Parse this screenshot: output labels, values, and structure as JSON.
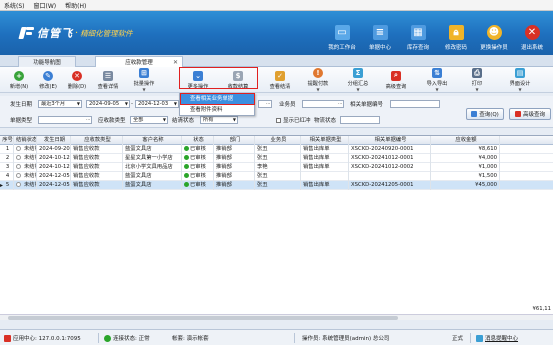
{
  "menu": [
    "系统(S)",
    "窗口(W)",
    "帮助(H)"
  ],
  "brand": {
    "name": "信管飞",
    "subtitle": "精细化管理软件"
  },
  "topnav": [
    {
      "label": "我的工作台",
      "icon": "monitor-icon",
      "color": "#5aa8e8"
    },
    {
      "label": "单据中心",
      "icon": "document-icon",
      "color": "#4f9be0"
    },
    {
      "label": "库存查询",
      "icon": "table-icon",
      "color": "#4f9be0"
    },
    {
      "label": "修改密码",
      "icon": "lock-icon",
      "color": "#f0b429"
    },
    {
      "label": "更换操作员",
      "icon": "user-icon",
      "color": "#f0b429"
    },
    {
      "label": "退出系统",
      "icon": "close-icon",
      "color": "#d93025"
    }
  ],
  "tabs": [
    {
      "label": "功能导航图",
      "active": false
    },
    {
      "label": "应收款管理",
      "active": true
    }
  ],
  "toolbar": [
    {
      "label": "新增(N)",
      "icon": "add-icon",
      "color": "#38a33a",
      "arrow": false
    },
    {
      "label": "修改(E)",
      "icon": "edit-icon",
      "color": "#3b7fd4",
      "arrow": false
    },
    {
      "label": "删除(D)",
      "icon": "delete-icon",
      "color": "#d93025",
      "arrow": false
    },
    {
      "label": "查看详情",
      "icon": "view-icon",
      "color": "#7a8aa0",
      "arrow": false
    },
    {
      "label": "批量操作",
      "icon": "batch-icon",
      "color": "#3b7fd4",
      "arrow": true
    },
    {
      "label": "更多操作",
      "icon": "more-icon",
      "color": "#3b7fd4",
      "arrow": true
    },
    {
      "label": "收款结算",
      "icon": "payment-icon",
      "color": "#9aa5b4",
      "arrow": false
    },
    {
      "label": "查看结清",
      "icon": "settled-icon",
      "color": "#e0a030",
      "arrow": false
    },
    {
      "label": "提醒付款",
      "icon": "remind-icon",
      "color": "#e07830",
      "arrow": true
    },
    {
      "label": "分组汇总",
      "icon": "group-icon",
      "color": "#3b9fd4",
      "arrow": true
    },
    {
      "label": "高级查询",
      "icon": "advanced-search-icon",
      "color": "#d93025",
      "arrow": false
    },
    {
      "label": "导入导出",
      "icon": "import-export-icon",
      "color": "#3b7fd4",
      "arrow": true
    },
    {
      "label": "打印",
      "icon": "print-icon",
      "color": "#5a6f8a",
      "arrow": true
    },
    {
      "label": "界面设计",
      "icon": "design-icon",
      "color": "#3b9fd4",
      "arrow": true
    }
  ],
  "dropdown": [
    "查看相关业务单据",
    "查看附件资料"
  ],
  "filters": {
    "date_label": "发生日期",
    "date_range": "最近3个月",
    "date_from": "2024-09-05",
    "date_to": "2024-12-03",
    "operator_label": "业务员",
    "ref_label": "相关单据编号",
    "unit_label": "单据类型",
    "type_label": "应收款类型",
    "type_value": "全部",
    "status_label": "结清状态",
    "status_value": "所有",
    "show_red_label": "显示已红冲",
    "logistics_label": "物流状态",
    "query_button": "查询(Q)",
    "advanced_button": "高级查询"
  },
  "table": {
    "columns": [
      "序号",
      "结销状态",
      "发生日期",
      "应收款类型",
      "客户名称",
      "状态",
      "部门",
      "业务员",
      "相关单据类型",
      "相关单据编号",
      "应收金额"
    ],
    "rows": [
      [
        "1",
        "未结销",
        "2024-09-20 00:00",
        "销售应收款",
        "蓝蛋文具店",
        "已审核",
        "推销部",
        "张丑",
        "销售出库单",
        "XSCKD-20240920-0001",
        "¥8,610"
      ],
      [
        "2",
        "未结销",
        "2024-10-12 00:00",
        "销售应收款",
        "星星文具第一小学店",
        "已审核",
        "推销部",
        "张丑",
        "销售出库单",
        "XSCKD-20241012-0001",
        "¥4,000"
      ],
      [
        "3",
        "未结销",
        "2024-10-12 00:00",
        "销售应收款",
        "北京小学文具用品店",
        "已审核",
        "推销部",
        "李艳",
        "销售出库单",
        "XSCKD-20241012-0002",
        "¥1,000"
      ],
      [
        "4",
        "未结销",
        "2024-12-05 00:00",
        "销售应收款",
        "蓝蛋文具店",
        "已审核",
        "推销部",
        "张丑",
        "",
        "",
        "¥1,500"
      ],
      [
        "5",
        "未结销",
        "2024-12-05 00:00",
        "销售应收款",
        "蓝蛋文具店",
        "已审核",
        "推销部",
        "张丑",
        "销售出库单",
        "XSCKD-20241205-0001",
        "¥45,000"
      ]
    ],
    "selected_row": 4,
    "total": "¥61,11"
  },
  "status": {
    "center": "应用中心: 127.0.0.1:7095",
    "connection": "连接状态: 正常",
    "account": "帐套: 演示帐套",
    "operator": "操作员: 系统管理员(admin) 总公司",
    "edition": "正式",
    "message": "消息提醒中心"
  },
  "colors": {
    "banner": "#1e6fbd",
    "accent": "#3c8fe0",
    "highlight": "#e02020",
    "approved": "#2aa52a"
  }
}
